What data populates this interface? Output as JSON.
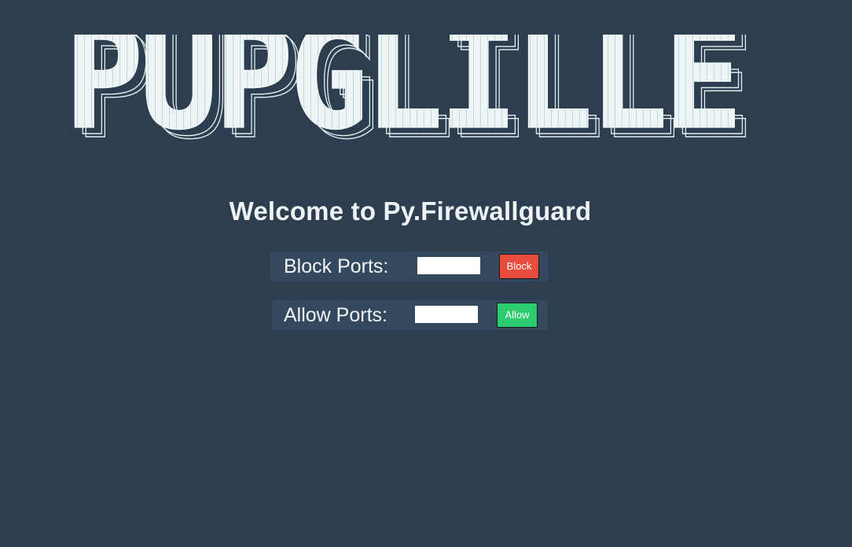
{
  "banner": {
    "text": "PUPGLILLE"
  },
  "welcome": {
    "title": "Welcome to Py.Firewallguard"
  },
  "block": {
    "label": "Block Ports:",
    "input_value": "",
    "button_label": "Block",
    "button_color": "#e74c3c"
  },
  "allow": {
    "label": "Allow Ports:",
    "input_value": "",
    "button_label": "Allow",
    "button_color": "#2ecc71"
  },
  "colors": {
    "background": "#2d3e50",
    "row_background": "#34495e",
    "text": "#eef2f4"
  }
}
